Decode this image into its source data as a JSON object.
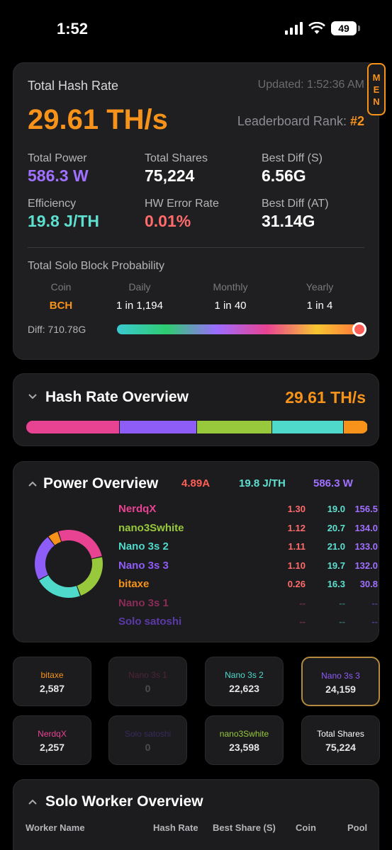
{
  "status_bar": {
    "time": "1:52",
    "battery": "49"
  },
  "hash_card": {
    "title": "Total Hash Rate",
    "updated": "Updated: 1:52:36 AM",
    "hashrate": "29.61 TH/s",
    "rank_label": "Leaderboard Rank:",
    "rank_value": "#2",
    "menu_letters": [
      "M",
      "E",
      "N"
    ],
    "stats": [
      {
        "label": "Total Power",
        "value": "586.3 W",
        "color": "#a070ff"
      },
      {
        "label": "Total Shares",
        "value": "75,224",
        "color": "#ffffff"
      },
      {
        "label": "Best Diff (S)",
        "value": "6.56G",
        "color": "#ffffff"
      },
      {
        "label": "Efficiency",
        "value": "19.8 J/TH",
        "color": "#5ee0d0"
      },
      {
        "label": "HW Error Rate",
        "value": "0.01%",
        "color": "#ff6b6b"
      },
      {
        "label": "Best Diff (AT)",
        "value": "31.14G",
        "color": "#ffffff"
      }
    ],
    "solo": {
      "title": "Total Solo Block Probability",
      "headers": [
        "Coin",
        "Daily",
        "Monthly",
        "Yearly"
      ],
      "values": [
        "BCH",
        "1 in 1,194",
        "1 in 40",
        "1 in 4"
      ],
      "diff": "Diff: 710.78G"
    }
  },
  "hash_overview": {
    "title": "Hash Rate Overview",
    "value": "29.61 TH/s",
    "segments": [
      {
        "fraction": 0.274,
        "color": "#e84393"
      },
      {
        "fraction": 0.225,
        "color": "#8e5cf7"
      },
      {
        "fraction": 0.22,
        "color": "#98c93c"
      },
      {
        "fraction": 0.21,
        "color": "#4fd9cb"
      },
      {
        "fraction": 0.071,
        "color": "#f7931a"
      }
    ]
  },
  "power_overview": {
    "title": "Power Overview",
    "amps": "4.89A",
    "efficiency": "19.8 J/TH",
    "watts": "586.3 W",
    "rows": [
      {
        "name": "NerdqX",
        "amps": "1.30",
        "eff": "19.0",
        "watts": "156.5",
        "color": "#e84393",
        "dim": false
      },
      {
        "name": "nano3Swhite",
        "amps": "1.12",
        "eff": "20.7",
        "watts": "134.0",
        "color": "#98c93c",
        "dim": false
      },
      {
        "name": "Nano 3s 2",
        "amps": "1.11",
        "eff": "21.0",
        "watts": "133.0",
        "color": "#4fd9cb",
        "dim": false
      },
      {
        "name": "Nano 3s 3",
        "amps": "1.10",
        "eff": "19.7",
        "watts": "132.0",
        "color": "#8e5cf7",
        "dim": false
      },
      {
        "name": "bitaxe",
        "amps": "0.26",
        "eff": "16.3",
        "watts": "30.8",
        "color": "#f7931a",
        "dim": false
      },
      {
        "name": "Nano 3s 1",
        "amps": "--",
        "eff": "--",
        "watts": "--",
        "color": "#8a2c57",
        "dim": true
      },
      {
        "name": "Solo satoshi",
        "amps": "--",
        "eff": "--",
        "watts": "--",
        "color": "#5b3aa8",
        "dim": true
      }
    ],
    "donut": [
      {
        "value": 156.5,
        "color": "#e84393"
      },
      {
        "value": 134.0,
        "color": "#98c93c"
      },
      {
        "value": 133.0,
        "color": "#4fd9cb"
      },
      {
        "value": 132.0,
        "color": "#8e5cf7"
      },
      {
        "value": 30.8,
        "color": "#f7931a"
      }
    ]
  },
  "tiles": [
    {
      "name": "bitaxe",
      "value": "2,587",
      "color": "#f7931a",
      "active": false,
      "dim": false
    },
    {
      "name": "Nano 3s 1",
      "value": "0",
      "color": "#8a2c57",
      "active": false,
      "dim": true
    },
    {
      "name": "Nano 3s 2",
      "value": "22,623",
      "color": "#4fd9cb",
      "active": false,
      "dim": false
    },
    {
      "name": "Nano 3s 3",
      "value": "24,159",
      "color": "#8e5cf7",
      "active": true,
      "dim": false
    },
    {
      "name": "NerdqX",
      "value": "2,257",
      "color": "#e84393",
      "active": false,
      "dim": false
    },
    {
      "name": "Solo satoshi",
      "value": "0",
      "color": "#5b3aa8",
      "active": false,
      "dim": true
    },
    {
      "name": "nano3Swhite",
      "value": "23,598",
      "color": "#98c93c",
      "active": false,
      "dim": false
    },
    {
      "name": "Total Shares",
      "value": "75,224",
      "color": "#ffffff",
      "active": false,
      "dim": false
    }
  ],
  "solo_worker": {
    "title": "Solo Worker Overview",
    "columns": [
      "Worker Name",
      "Hash Rate",
      "Best Share (S)",
      "Coin",
      "Pool"
    ]
  }
}
